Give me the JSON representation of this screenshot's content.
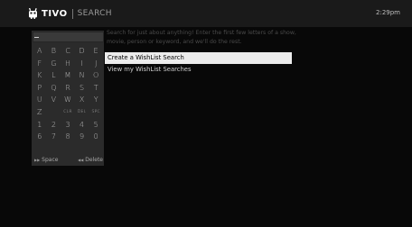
{
  "header": {
    "brand": "TIVO",
    "screen_title": "SEARCH",
    "clock": "2:29pm",
    "logo_icon": "tivo-logo-icon"
  },
  "search": {
    "value": ""
  },
  "keyboard": {
    "keys": [
      "A",
      "B",
      "C",
      "D",
      "E",
      "F",
      "G",
      "H",
      "I",
      "J",
      "K",
      "L",
      "M",
      "N",
      "O",
      "P",
      "Q",
      "R",
      "S",
      "T",
      "U",
      "V",
      "W",
      "X",
      "Y",
      "Z",
      "",
      "CLR",
      "DEL",
      "SPC",
      "1",
      "2",
      "3",
      "4",
      "5",
      "6",
      "7",
      "8",
      "9",
      "0"
    ],
    "space_hint": "Space",
    "space_icon": "fast-forward-icon",
    "delete_hint": "Delete",
    "delete_icon": "rewind-icon"
  },
  "instructions": "Search for just about anything! Enter the first few letters of a show, movie, person or keyword, and we'll do the rest.",
  "menu": {
    "items": [
      {
        "label": "Create a WishList Search",
        "selected": true
      },
      {
        "label": "View my WishList Searches",
        "selected": false
      }
    ]
  },
  "colors": {
    "background": "#080808",
    "topbar": "#1a1a1a",
    "keyboard_panel": "#2b2b2b",
    "highlight": "#ececec"
  }
}
